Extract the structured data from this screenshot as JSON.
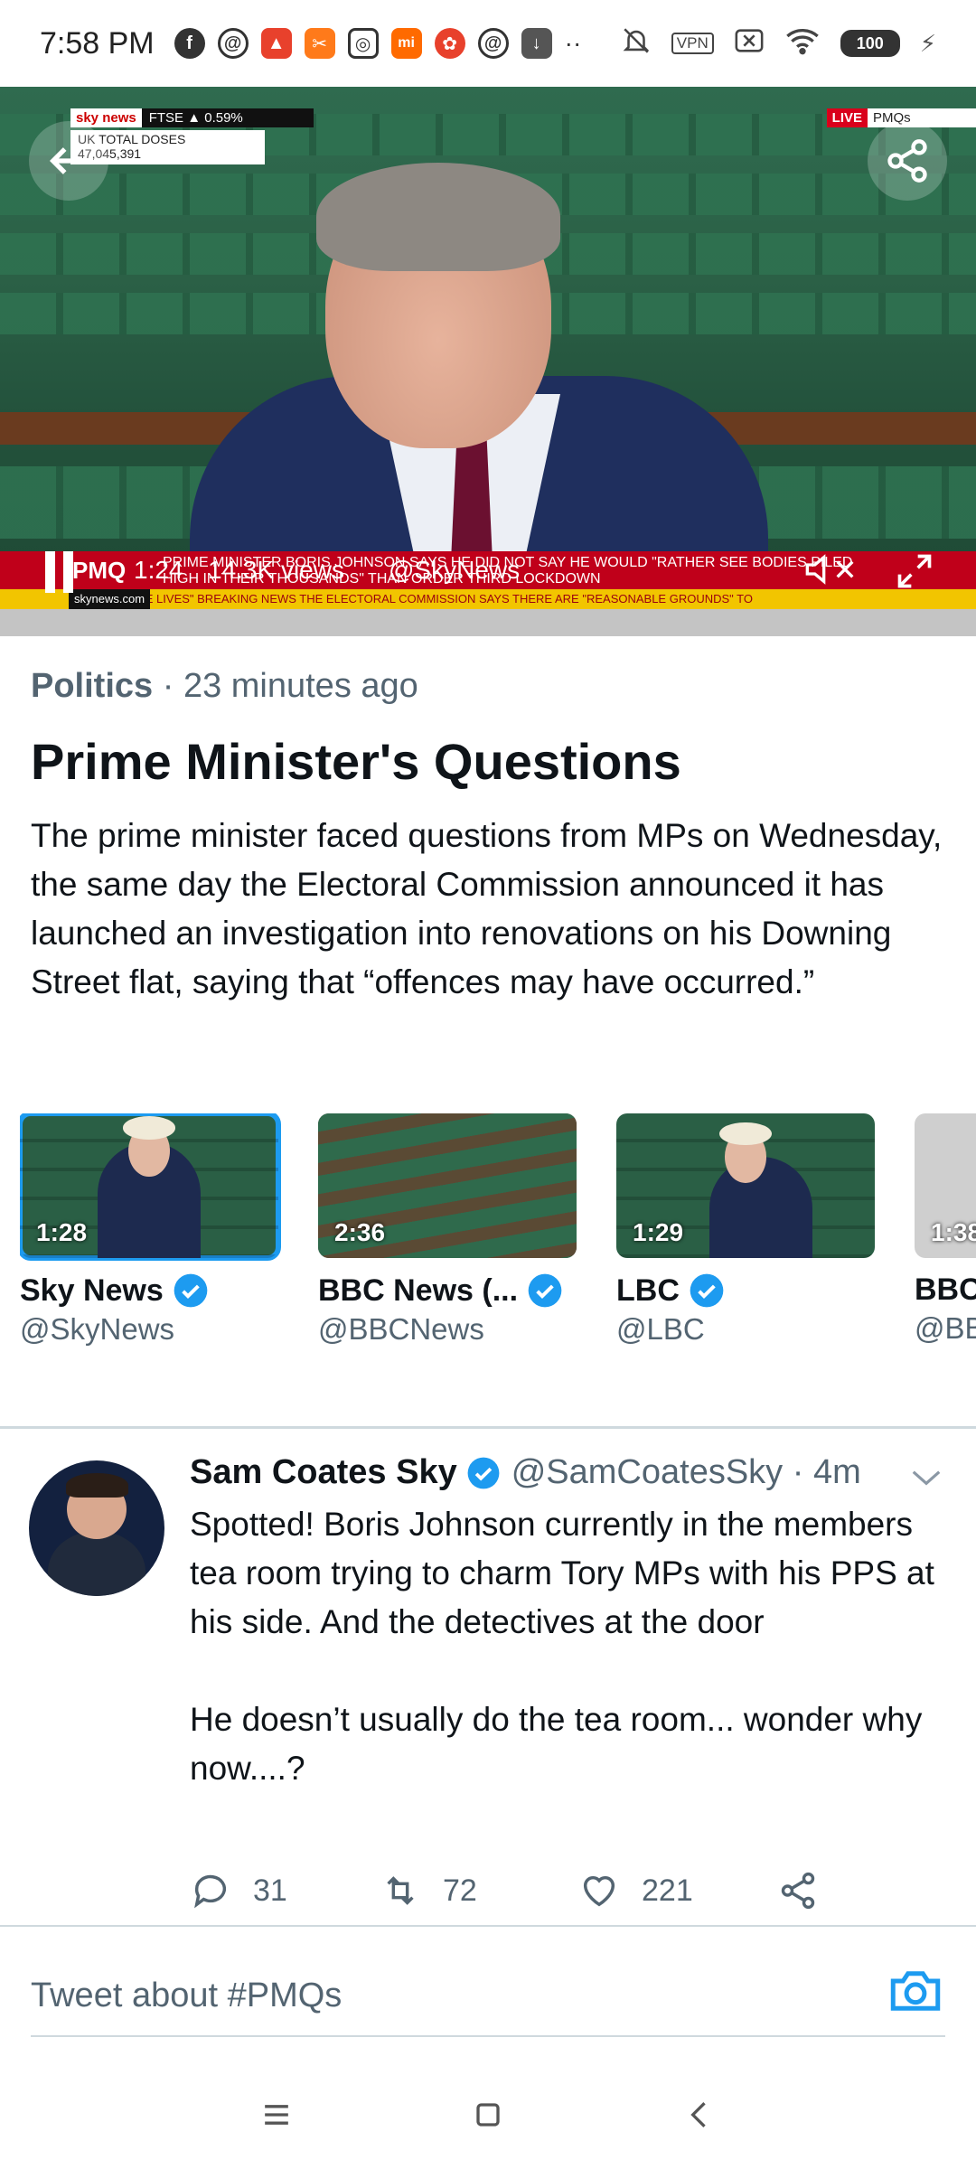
{
  "status_bar": {
    "time": "7:58 PM",
    "app_icons": [
      "facebook-icon",
      "threads-icon",
      "app-red-icon",
      "app-orange-icon",
      "instagram-icon",
      "mi-icon",
      "app-red2-icon",
      "threads-icon",
      "download-icon"
    ],
    "more": "··",
    "vpn": "VPN",
    "battery": "100",
    "colors": {
      "mi": "#ff6a00",
      "red": "#e8412c",
      "orange": "#ff7a1a",
      "download": "#555555"
    }
  },
  "video": {
    "overlay": {
      "sky_logo": "sky news",
      "ftse": "FTSE ▲ 0.59%",
      "doses_label": "UK TOTAL DOSES",
      "doses_value": "47,045,391",
      "live": "LIVE",
      "live_label": "PMQs",
      "ticker_headline": "Prime Minister Boris Johnson says he did not say he would \"rather see bodies piled high in their thousands\" than order third lockdown",
      "sky_url": "skynews.com",
      "ticker_bottom": "ND HELP SAVE LIVES\"   BREAKING NEWS   THE ELECTORAL COMMISSION SAYS THERE ARE \"REASONABLE GROUNDS\" TO"
    },
    "pmq_label": "PMQ",
    "time": "1:24",
    "views": "14.3K views",
    "handle": "@SkyNews"
  },
  "article": {
    "category": "Politics",
    "separator": " · ",
    "age": "23 minutes ago",
    "title": "Prime Minister's Questions",
    "summary": "The prime minister faced questions from MPs on Wednesday, the same day the Electoral Commission announced it has launched an investigation into renovations on his Downing Street flat, saying that “offences may have occurred.”"
  },
  "videos": [
    {
      "duration": "1:28",
      "name": "Sky News",
      "handle": "@SkyNews"
    },
    {
      "duration": "2:36",
      "name": "BBC News (...",
      "handle": "@BBCNews"
    },
    {
      "duration": "1:29",
      "name": "LBC",
      "handle": "@LBC"
    },
    {
      "duration": "1:38",
      "name": "BBC",
      "handle": "@BB"
    }
  ],
  "tweet": {
    "name": "Sam Coates Sky",
    "handle": "@SamCoatesSky · 4m",
    "text": "Spotted! Boris Johnson currently in the members tea room trying to charm Tory MPs with his PPS at his side. And the detectives at the door\n\nHe doesn’t usually do the tea room... wonder why now....?",
    "replies": "31",
    "retweets": "72",
    "likes": "221"
  },
  "compose": {
    "placeholder": "Tweet about #PMQs"
  },
  "colors": {
    "accent": "#1d9bf0",
    "text": "#0f1419",
    "secondary": "#536471",
    "sky_red": "#c0001a",
    "sky_yellow": "#f2c500"
  }
}
